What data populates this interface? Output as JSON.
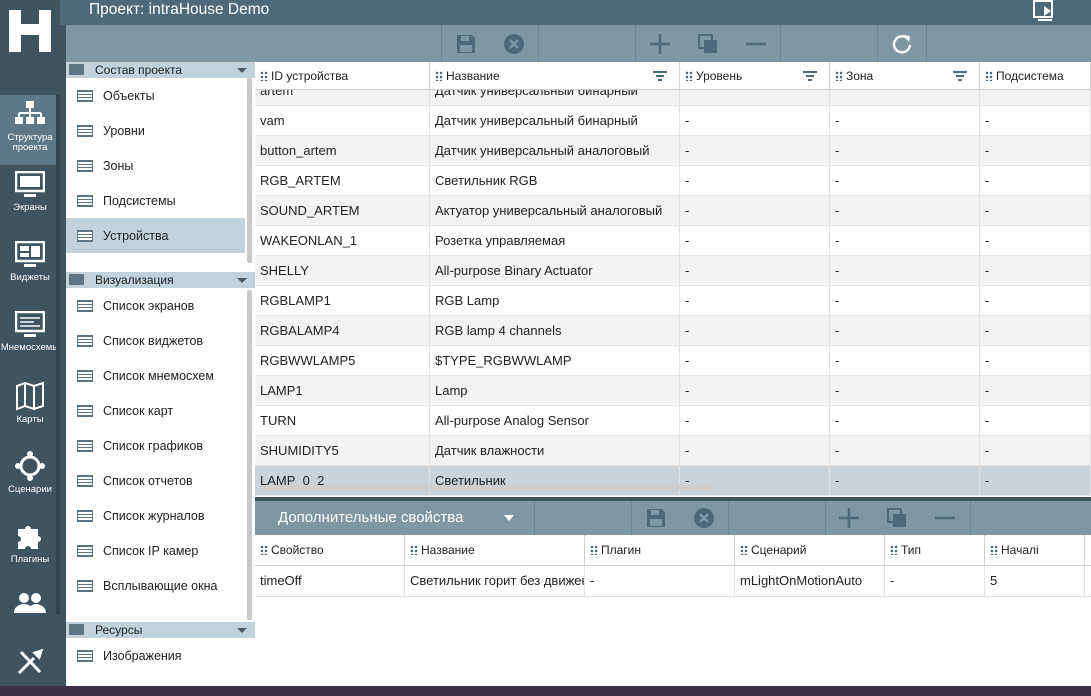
{
  "header": {
    "title": "Проект: intraHouse Demo"
  },
  "rail": {
    "items": [
      {
        "label": "Структура проекта",
        "icon": "structure-icon",
        "active": true
      },
      {
        "label": "Экраны",
        "icon": "monitor-icon"
      },
      {
        "label": "Виджеты",
        "icon": "widgets-icon"
      },
      {
        "label": "Мнемосхемы",
        "icon": "mnemo-icon"
      },
      {
        "label": "Карты",
        "icon": "map-icon"
      },
      {
        "label": "Сценарии",
        "icon": "scenario-icon"
      },
      {
        "label": "Плагины",
        "icon": "puzzle-icon"
      },
      {
        "label": "",
        "icon": "users-icon"
      }
    ]
  },
  "tree": {
    "sections": [
      {
        "title": "Состав проекта",
        "items": [
          "Объекты",
          "Уровни",
          "Зоны",
          "Подсистемы",
          "Устройства"
        ]
      },
      {
        "title": "Визуализация",
        "items": [
          "Список экранов",
          "Список виджетов",
          "Список мнемосхем",
          "Список карт",
          "Список графиков",
          "Список отчетов",
          "Список журналов",
          "Список IP камер",
          "Всплывающие окна"
        ]
      },
      {
        "title": "Ресурсы",
        "items": [
          "Изображения"
        ]
      }
    ]
  },
  "grid": {
    "columns": [
      "ID устройства",
      "Название",
      "Уровень",
      "Зона",
      "Подсистема"
    ],
    "rows": [
      [
        "artem",
        "Датчик универсальный бинарный",
        "",
        "",
        ""
      ],
      [
        "vam",
        "Датчик универсальный бинарный",
        "-",
        "-",
        "-"
      ],
      [
        "button_artem",
        "Датчик универсальный аналоговый",
        "-",
        "-",
        "-"
      ],
      [
        "RGB_ARTEM",
        "Светильник RGB",
        "-",
        "-",
        "-"
      ],
      [
        "SOUND_ARTEM",
        "Актуатор универсальный аналоговый",
        "-",
        "-",
        "-"
      ],
      [
        "WAKEONLAN_1",
        "Розетка управляемая",
        "-",
        "-",
        "-"
      ],
      [
        "SHELLY",
        "All-purpose Binary Actuator",
        "-",
        "-",
        "-"
      ],
      [
        "RGBLAMP1",
        "RGB Lamp",
        "-",
        "-",
        "-"
      ],
      [
        "RGBALAMP4",
        "RGB lamp 4 channels",
        "-",
        "-",
        "-"
      ],
      [
        "RGBWWLAMP5",
        "$TYPE_RGBWWLAMP",
        "-",
        "-",
        "-"
      ],
      [
        "LAMP1",
        "Lamp",
        "-",
        "-",
        "-"
      ],
      [
        "TURN",
        "All-purpose Analog Sensor",
        "-",
        "-",
        "-"
      ],
      [
        "SHUMIDITY5",
        "Датчик влажности",
        "-",
        "-",
        "-"
      ],
      [
        "LAMP_0_2",
        "Светильник",
        "-",
        "-",
        "-"
      ]
    ]
  },
  "bottom_panel": {
    "title": "Дополнительные свойства",
    "columns": [
      "Свойство",
      "Название",
      "Плагин",
      "Сценарий",
      "Тип",
      "Началі"
    ],
    "row": [
      "timeOff",
      "Светильник горит без движения",
      "-",
      "mLightOnMotionAuto",
      "-",
      "5"
    ]
  }
}
